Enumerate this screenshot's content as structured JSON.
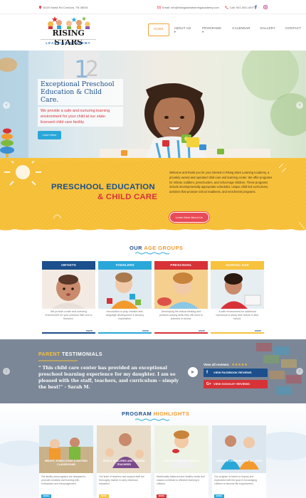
{
  "topbar": {
    "address": "6220 Santa Rd Cordova, TN 38016",
    "email": "Email: info@risingstarslearningacademy.com",
    "phone": "Call: 901-000-1097"
  },
  "logo": {
    "title": "RISING STARS",
    "subtitle": "LEARNING ACADEMY"
  },
  "nav": {
    "items": [
      "HOME",
      "ABOUT US",
      "PROGRAMS",
      "CALENDAR",
      "GALLERY",
      "CONTACT"
    ],
    "active": "HOME"
  },
  "hero": {
    "title": "Exceptional Preschool Education & Child Care.",
    "text": "We provide a safe and nurturing learning environment for your child at our state-licensed child care facility.",
    "button": "Learn More"
  },
  "intro": {
    "heading_line1": "PRESCHOOL EDUCATION",
    "heading_line2": "& CHILD CARE",
    "paragraph": "Welcome and thank you for your interest in Rising Stars Learning Academy, a privately owned and operated child care and learning center. We offer programs for infants, toddlers, preschoolers, and school-age children. These programs include developmentally appropriate schedules, unique child-led curriculums, activities that promote school readiness, and enrichment programs.",
    "button": "Learn More About Us"
  },
  "age_groups": {
    "title_a": "OUR",
    "title_b": "AGE GROUPS",
    "cards": [
      {
        "tag": "INFANTS",
        "desc": "We provide a safe and nurturing environment for your precious little one to blossom.",
        "more": "more",
        "color": "#1c4f8c"
      },
      {
        "tag": "TODDLERS",
        "desc": "Introduction to play creative arts, language development & sensory exploration.",
        "more": "more",
        "color": "#2aa7d9"
      },
      {
        "tag": "PRESCHOOL",
        "desc": "Developing the critical thinking and problem-solving skills they will need to succeed in school.",
        "more": "more",
        "color": "#d73237"
      },
      {
        "tag": "SCHOOL-AGE",
        "desc": "A safe environment for additional homework & study time before & after school.",
        "more": "more",
        "color": "#f7c23d"
      }
    ]
  },
  "testimonials": {
    "title_a": "PARENT",
    "title_b": "TESTIMONIALS",
    "quote": "“ This child care center has provided an exceptional preschool learning experience for my daughter.  I am so pleased with the staff, teachers, and curriculum – simply the best!” - Sarah M.",
    "reviews_label": "View all reviews:",
    "stars": "★★★★★",
    "facebook_button": "VIEW FACEBOOK REVIEWS",
    "google_button": "VIEW GOOGLE+ REVIEWS"
  },
  "programs": {
    "title_a": "PROGRAM",
    "title_b": "HIGHLIGHTS",
    "cards": [
      {
        "caption": "BRIGHT, STIMULATING & INVITING CLASSROOMS",
        "desc": "Our facility and programs are designed to promote creativity and learning with enthusiasm and encouragement.",
        "more": "MORE",
        "color": "#2aa7d9"
      },
      {
        "caption": "HIGHLY QUALIFIED AND TRAINED TEACHERS",
        "desc": "Our team of teachers and support staff are thoroughly trained in early childhood education.",
        "more": "MORE",
        "color": "#f7c23d"
      },
      {
        "caption": "HEALTHY SNACKS & MEALS",
        "desc": "Nutritionally-balanced and healthy meals and snacks contribute to effective learning in children.",
        "more": "MORE",
        "color": "#d73237"
      },
      {
        "caption": "CREATIVE LEARNING FOR ALL AGES",
        "desc": "Our program is based on Inquiry and exploration with the goal of encouraging children to become life-long learners.",
        "more": "MORE",
        "color": "#2aa7d9"
      }
    ]
  }
}
